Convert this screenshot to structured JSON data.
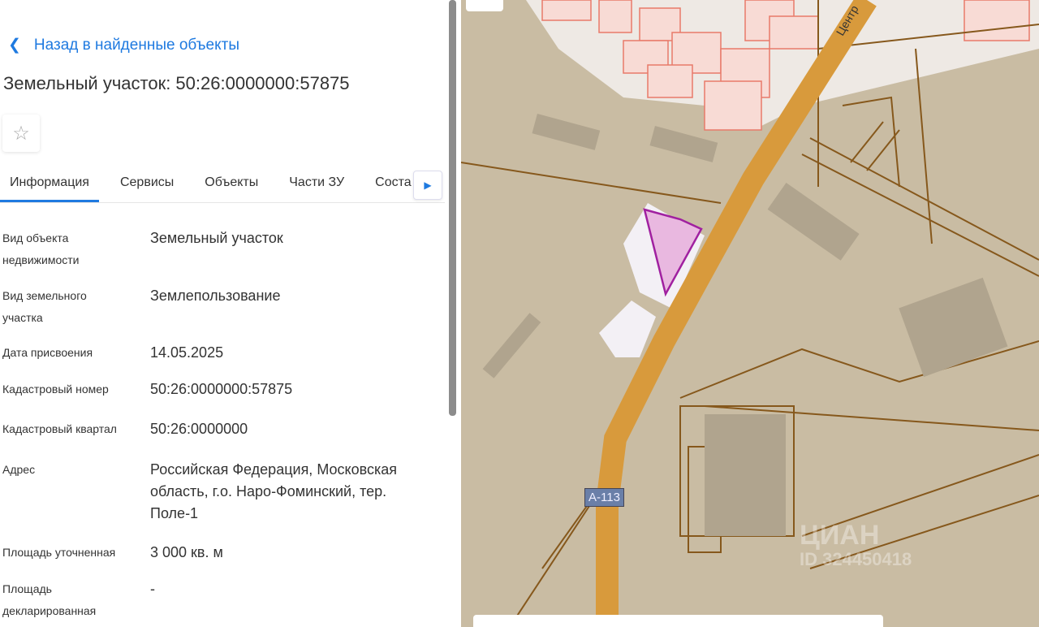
{
  "back_link": "Назад в найденные объекты",
  "title": "Земельный участок: 50:26:0000000:57875",
  "tabs": [
    "Информация",
    "Сервисы",
    "Объекты",
    "Части ЗУ",
    "Соста"
  ],
  "active_tab": "Информация",
  "fields": [
    {
      "label": "Вид объекта недвижимости",
      "value": "Земельный участок"
    },
    {
      "label": "Вид земельного участка",
      "value": "Землепользование"
    },
    {
      "label": "Дата присвоения",
      "value": "14.05.2025"
    },
    {
      "label": "Кадастровый номер",
      "value": "50:26:0000000:57875"
    },
    {
      "label": "Кадастровый квартал",
      "value": "50:26:0000000"
    },
    {
      "label": "Адрес",
      "value": "Российская Федерация, Московская область, г.о. Наро-Фоминский, тер. Поле-1"
    },
    {
      "label": "Площадь уточненная",
      "value": "3 000 кв. м"
    },
    {
      "label": "Площадь декларированная",
      "value": "-"
    }
  ],
  "map": {
    "road_label": "А-113",
    "street_label": "Центр",
    "watermark": "ЦИАН",
    "watermark_id": "ID 324450418",
    "colors": {
      "land": "#c9bca3",
      "parcel_line": "#86581c",
      "road": "#d89a3c",
      "selected": "#a020a0",
      "residential": "#f7d6d0"
    }
  },
  "icons": {
    "back": "chevron-left-icon",
    "favorite": "star-icon",
    "tab_next": "caret-right-icon"
  }
}
